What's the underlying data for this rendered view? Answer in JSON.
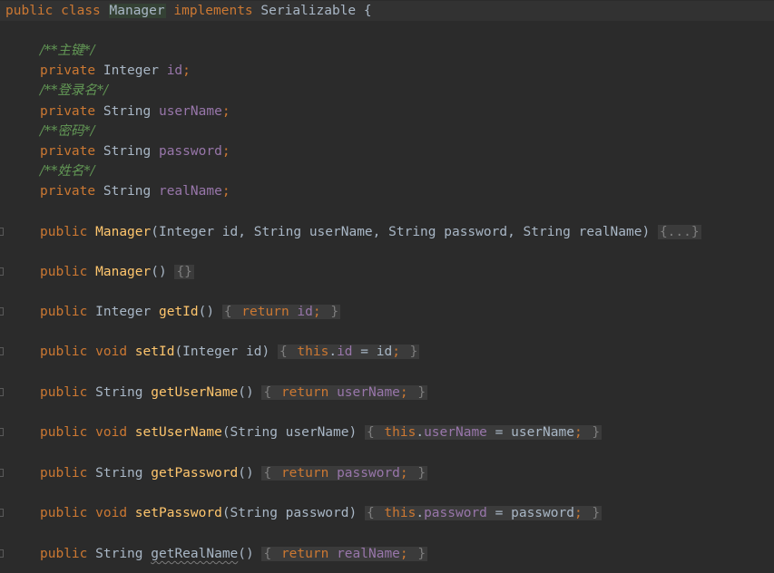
{
  "class_decl": {
    "kw_public": "public",
    "kw_class": "class",
    "name": "Manager",
    "kw_implements": "implements",
    "iface": "Serializable",
    "brace": "{"
  },
  "fields": [
    {
      "comment": "/**主键*/",
      "modifier": "private",
      "type": "Integer",
      "name": "id"
    },
    {
      "comment": "/**登录名*/",
      "modifier": "private",
      "type": "String",
      "name": "userName"
    },
    {
      "comment": "/**密码*/",
      "modifier": "private",
      "type": "String",
      "name": "password"
    },
    {
      "comment": "/**姓名*/",
      "modifier": "private",
      "type": "String",
      "name": "realName"
    }
  ],
  "constructor_full": {
    "kw": "public",
    "name": "Manager",
    "params": "(Integer id, String userName, String password, String realName)",
    "folded": "{...}"
  },
  "constructor_empty": {
    "kw": "public",
    "name": "Manager",
    "params": "()",
    "folded": "{}"
  },
  "methods": {
    "getId": {
      "kw": "public",
      "ret": "Integer",
      "name": "getId",
      "params": "()",
      "body_open": "{",
      "body_kw": "return",
      "body_field": "id",
      "semi": ";",
      "body_close": "}"
    },
    "setId": {
      "kw": "public",
      "ret": "void",
      "name": "setId",
      "params": "(Integer id)",
      "body_open": "{",
      "this_kw": "this",
      "field": "id",
      "rhs": " = id",
      "semi": ";",
      "body_close": "}"
    },
    "getUserName": {
      "kw": "public",
      "ret": "String",
      "name": "getUserName",
      "params": "()",
      "body_open": "{",
      "body_kw": "return",
      "body_field": "userName",
      "semi": ";",
      "body_close": "}"
    },
    "setUserName": {
      "kw": "public",
      "ret": "void",
      "name": "setUserName",
      "params": "(String userName)",
      "body_open": "{",
      "this_kw": "this",
      "field": "userName",
      "rhs": " = userName",
      "semi": ";",
      "body_close": "}"
    },
    "getPassword": {
      "kw": "public",
      "ret": "String",
      "name": "getPassword",
      "params": "()",
      "body_open": "{",
      "body_kw": "return",
      "body_field": "password",
      "semi": ";",
      "body_close": "}"
    },
    "setPassword": {
      "kw": "public",
      "ret": "void",
      "name": "setPassword",
      "params": "(String password)",
      "body_open": "{",
      "this_kw": "this",
      "field": "password",
      "rhs": " = password",
      "semi": ";",
      "body_close": "}"
    },
    "getRealName": {
      "kw": "public",
      "ret": "String",
      "name": "getRealName",
      "params": "()",
      "body_open": "{",
      "body_kw": "return",
      "body_field": "realName",
      "semi": ";",
      "body_close": "}"
    }
  },
  "colors": {
    "background": "#2b2b2b",
    "keyword": "#cc7832",
    "method": "#ffc66d",
    "field": "#9876aa",
    "comment": "#629755",
    "text": "#a9b7c6"
  }
}
